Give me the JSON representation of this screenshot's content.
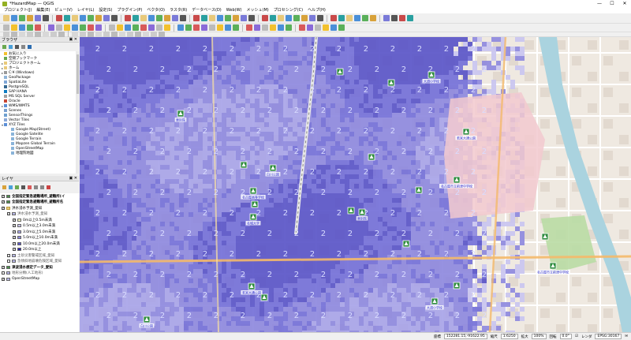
{
  "window": {
    "title": "*HazardMap — QGIS",
    "controls": [
      "—",
      "☐",
      "✕"
    ]
  },
  "menu": [
    "プロジェクト(J)",
    "編集(E)",
    "ビュー(V)",
    "レイヤ(L)",
    "設定(S)",
    "プラグイン(P)",
    "ベクタ(O)",
    "ラスタ(R)",
    "データベース(D)",
    "Web(W)",
    "メッシュ(M)",
    "プロセシング(C)",
    "ヘルプ(H)"
  ],
  "browser_panel": {
    "title": "ブラウザ",
    "items": [
      {
        "label": "お気に入り",
        "icon": "star-icon",
        "color": "#f2c12e",
        "expand": ""
      },
      {
        "label": "空間ブックマーク",
        "icon": "bookmark-icon",
        "color": "#6aa84f",
        "expand": ""
      },
      {
        "label": "プロジェクトホーム",
        "icon": "folder-icon",
        "color": "#e8c97a",
        "expand": "▸"
      },
      {
        "label": "ホーム",
        "icon": "folder-icon",
        "color": "#e8c97a",
        "expand": "▸"
      },
      {
        "label": "C:¥ (Windows)",
        "icon": "drive-icon",
        "color": "#9a9a9a",
        "expand": "▸"
      },
      {
        "label": "GeoPackage",
        "icon": "geopackage-icon",
        "color": "#8fb4d9",
        "expand": ""
      },
      {
        "label": "SpatiaLite",
        "icon": "spatialite-icon",
        "color": "#7fa6d6",
        "expand": ""
      },
      {
        "label": "PostgreSQL",
        "icon": "postgresql-icon",
        "color": "#336791",
        "expand": ""
      },
      {
        "label": "SAP HANA",
        "icon": "database-icon",
        "color": "#0f7dc2",
        "expand": ""
      },
      {
        "label": "MS SQL Server",
        "icon": "database-icon",
        "color": "#a0a0a0",
        "expand": ""
      },
      {
        "label": "Oracle",
        "icon": "database-icon",
        "color": "#c74634",
        "expand": ""
      },
      {
        "label": "WMS/WMTS",
        "icon": "globe-icon",
        "color": "#5c8fd6",
        "expand": "▸"
      },
      {
        "label": "Scenes",
        "icon": "scene-icon",
        "color": "#7aa0d0",
        "expand": ""
      },
      {
        "label": "SensorThings",
        "icon": "sensor-icon",
        "color": "#6fa0d0",
        "expand": ""
      },
      {
        "label": "Vector Tiles",
        "icon": "vector-tiles-icon",
        "color": "#8aa8d8",
        "expand": ""
      },
      {
        "label": "XYZ Tiles",
        "icon": "grid-icon",
        "color": "#5c8fd6",
        "expand": "▾"
      },
      {
        "label": "Google Map(Street)",
        "icon": "tile-icon",
        "color": "#8ab4d9",
        "expand": "",
        "indent": true
      },
      {
        "label": "Google Satelite",
        "icon": "tile-icon",
        "color": "#8ab4d9",
        "expand": "",
        "indent": true
      },
      {
        "label": "Google Terrain",
        "icon": "tile-icon",
        "color": "#8ab4d9",
        "expand": "",
        "indent": true
      },
      {
        "label": "Mapzen Global Terrain",
        "icon": "tile-icon",
        "color": "#8ab4d9",
        "expand": "",
        "indent": true
      },
      {
        "label": "OpenStreetMap",
        "icon": "tile-icon",
        "color": "#8ab4d9",
        "expand": "",
        "indent": true
      },
      {
        "label": "地理院地図",
        "icon": "tile-icon",
        "color": "#8ab4d9",
        "expand": "",
        "indent": true
      }
    ]
  },
  "layers_panel": {
    "title": "レイヤ",
    "rows": [
      {
        "label": "全国指定緊急避難場所_避難所(イ",
        "kind": "check",
        "checked": true,
        "indent": 0,
        "bold": true
      },
      {
        "label": "全国指定緊急避難場所_避難所名",
        "kind": "check",
        "checked": true,
        "indent": 0,
        "bold": true
      },
      {
        "label": "洪水浸水予測_愛知",
        "kind": "group",
        "checked": true,
        "indent": 0,
        "bold": false
      },
      {
        "label": "洪水浸水予測_愛知",
        "kind": "check",
        "checked": true,
        "indent": 1,
        "bold": false,
        "muted": true
      },
      {
        "label": "0m以上0.5m未満",
        "kind": "swatch",
        "color": "#f7f7c6",
        "checked": true,
        "indent": 2
      },
      {
        "label": "0.5m以上3.0m未満",
        "kind": "swatch",
        "color": "#c9c4f0",
        "checked": true,
        "indent": 2
      },
      {
        "label": "3.0m以上5.0m未満",
        "kind": "swatch",
        "color": "#a8a4e8",
        "checked": true,
        "indent": 2
      },
      {
        "label": "5.0m以上10.0m未満",
        "kind": "swatch",
        "color": "#8e89de",
        "checked": true,
        "indent": 2
      },
      {
        "label": "10.0m以上20.0m未満",
        "kind": "swatch",
        "color": "#5a55c8",
        "checked": true,
        "indent": 2
      },
      {
        "label": "20.0m以上",
        "kind": "swatch",
        "color": "#2a25a8",
        "checked": true,
        "indent": 2
      },
      {
        "label": "土砂災害警戒区域_愛知",
        "kind": "check",
        "checked": false,
        "indent": 1,
        "muted": true
      },
      {
        "label": "急傾斜地崩壊危険区域_愛知",
        "kind": "check",
        "checked": false,
        "indent": 1,
        "muted": true
      },
      {
        "label": "津波浸水想定データ_愛知",
        "kind": "check",
        "checked": true,
        "indent": 0,
        "bold": true
      },
      {
        "label": "地形分類(人工地形)",
        "kind": "check",
        "checked": false,
        "indent": 0,
        "muted": true
      },
      {
        "label": "OpenStreetMap",
        "kind": "check",
        "checked": true,
        "indent": 0,
        "bold": false
      }
    ]
  },
  "status": {
    "coord_label": "座標",
    "coord_value": "152281.15,-91622.95",
    "scale_label": "縮尺",
    "scale_value": "1:6250",
    "magnify_label": "拡大",
    "magnify_value": "100%",
    "rotation_label": "回転",
    "rotation_value": "0.0°",
    "render_label": "レンダ",
    "crs_label": "EPSG:30167"
  },
  "map": {
    "depth_label": "2",
    "shelter_labels": [
      "東別院",
      "名古屋市立橘小学校",
      "大須小学校",
      "名古屋市立老松小学校",
      "若宮大通公園",
      "名古屋市立大須小学校",
      "白川公園",
      "名古屋中学校",
      "名古屋市立前津中学校",
      "鶴舞小学校",
      "名古屋高等学校",
      "大須中学校",
      "名城大学",
      "名古屋市立松原小学校"
    ]
  }
}
